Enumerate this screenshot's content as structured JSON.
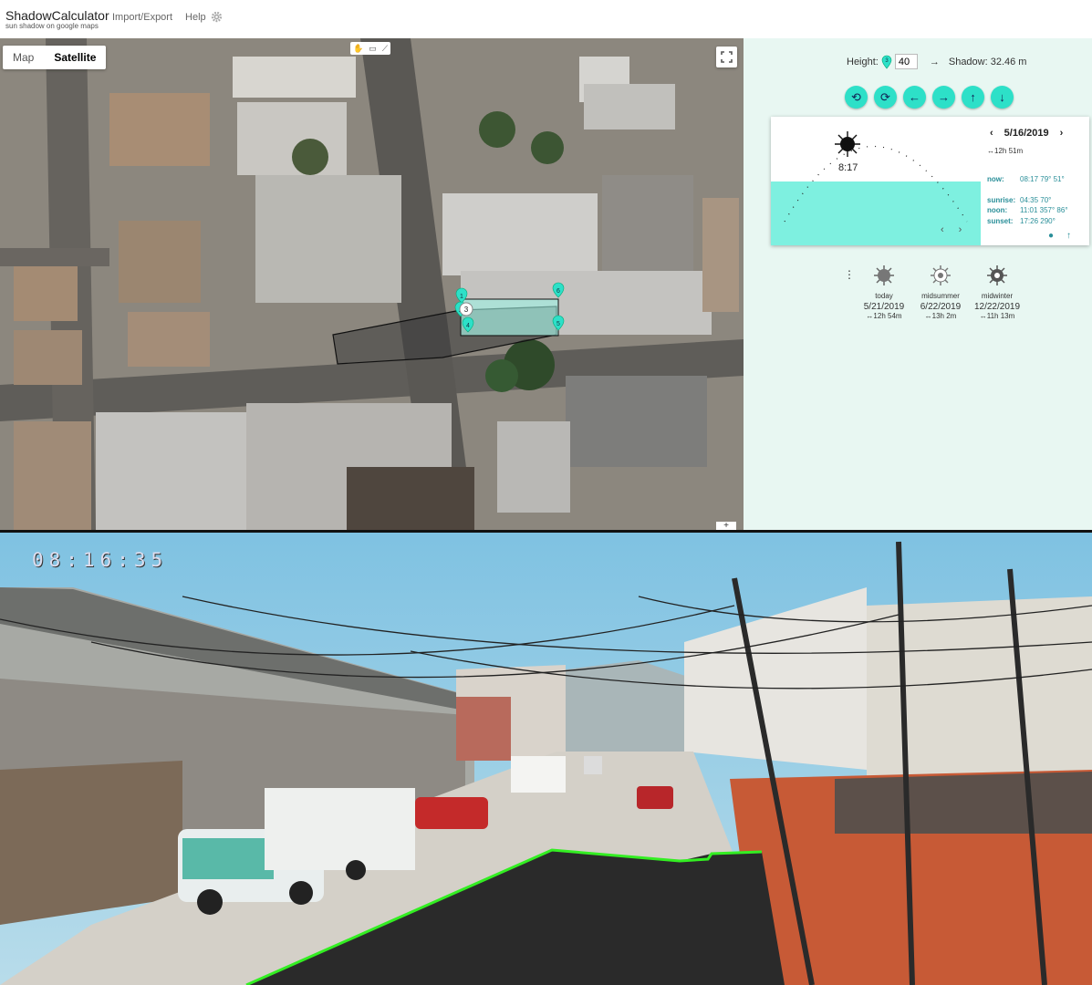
{
  "app": {
    "title": "ShadowCalculator",
    "subtitle": "sun shadow on google maps"
  },
  "nav": {
    "import_export": "Import/Export",
    "help": "Help",
    "settings_icon": "gear-icon"
  },
  "map": {
    "types": [
      "Map",
      "Satellite"
    ],
    "selected_type": "Satellite",
    "markers": [
      "1",
      "2",
      "3",
      "4",
      "5",
      "6"
    ]
  },
  "panel": {
    "height_label": "Height:",
    "height_marker": "3",
    "height_value": "40",
    "shadow_text": "Shadow: 32.46 m",
    "controls": [
      "rotate-ccw-icon",
      "rotate-cw-icon",
      "arrow-left-icon",
      "arrow-right-icon",
      "arrow-up-icon",
      "arrow-down-icon"
    ],
    "sun": {
      "date": "5/16/2019",
      "day_length": "↔12h 51m",
      "time": "8:17",
      "now_label": "now:",
      "now_value": "08:17   79°   51°",
      "sunrise_label": "sunrise:",
      "sunrise_value": "04:35  70°",
      "noon_label": "noon:",
      "noon_value": "11:01  357°  86°",
      "sunset_label": "sunset:",
      "sunset_value": "17:26  290°"
    },
    "presets": [
      {
        "name": "today",
        "date": "5/21/2019",
        "length": "↔12h 54m"
      },
      {
        "name": "midsummer",
        "date": "6/22/2019",
        "length": "↔13h 2m"
      },
      {
        "name": "midwinter",
        "date": "12/22/2019",
        "length": "↔11h 13m"
      }
    ]
  },
  "video": {
    "timestamp": "08:16:35"
  },
  "colors": {
    "accent": "#2de0c8",
    "panel_bg": "#e8f7f2",
    "shadow_line": "#33ee22"
  }
}
